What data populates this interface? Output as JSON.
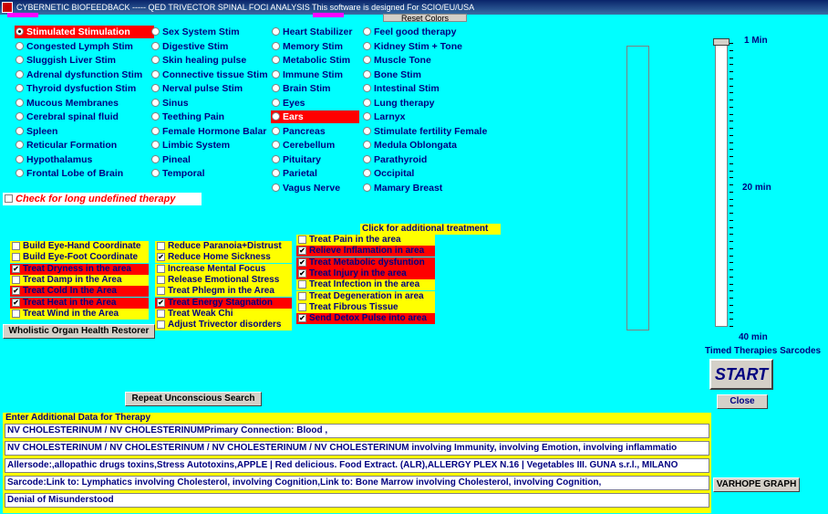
{
  "window": {
    "title": "CYBERNETIC BIOFEEDBACK  -----  QED   TRIVECTOR SPINAL FOCI ANALYSIS   This software is designed For SCIO/EU/USA",
    "reset_label": "Reset Colors"
  },
  "radios": {
    "col1": [
      {
        "label": "Stimulated Stimulation",
        "selected": true,
        "highlight": "red"
      },
      {
        "label": "Congested Lymph Stim"
      },
      {
        "label": "Sluggish Liver Stim"
      },
      {
        "label": "Adrenal dysfunction Stim"
      },
      {
        "label": "Thyroid dysfuction Stim"
      },
      {
        "label": "Mucous Membranes"
      },
      {
        "label": "Cerebral spinal fluid"
      },
      {
        "label": "Spleen"
      },
      {
        "label": "Reticular Formation"
      },
      {
        "label": "Hypothalamus"
      },
      {
        "label": "Frontal Lobe of Brain"
      }
    ],
    "col2": [
      {
        "label": "Sex System Stim"
      },
      {
        "label": "Digestive Stim"
      },
      {
        "label": "Skin healing pulse"
      },
      {
        "label": "Connective tissue Stim"
      },
      {
        "label": "Nerval pulse Stim"
      },
      {
        "label": "Sinus"
      },
      {
        "label": "Teething Pain"
      },
      {
        "label": "Female Hormone Balar"
      },
      {
        "label": "Limbic System"
      },
      {
        "label": "Pineal"
      },
      {
        "label": "Temporal"
      }
    ],
    "col3": [
      {
        "label": "Heart Stabilizer"
      },
      {
        "label": "Memory Stim"
      },
      {
        "label": "Metabolic Stim"
      },
      {
        "label": "Immune Stim"
      },
      {
        "label": "Brain Stim"
      },
      {
        "label": "Eyes"
      },
      {
        "label": "Ears",
        "highlight": "red"
      },
      {
        "label": "Pancreas"
      },
      {
        "label": "Cerebellum"
      },
      {
        "label": "Pituitary"
      },
      {
        "label": "Parietal"
      },
      {
        "label": "Vagus Nerve"
      }
    ],
    "col4": [
      {
        "label": "Feel good therapy"
      },
      {
        "label": "Kidney Stim + Tone"
      },
      {
        "label": "Muscle Tone"
      },
      {
        "label": "Bone Stim"
      },
      {
        "label": "Intestinal Stim"
      },
      {
        "label": "Lung therapy"
      },
      {
        "label": "Larnyx"
      },
      {
        "label": "Stimulate fertility Female"
      },
      {
        "label": "Medula Oblongata"
      },
      {
        "label": "Parathyroid"
      },
      {
        "label": "Occipital"
      },
      {
        "label": "Mamary  Breast"
      }
    ]
  },
  "long_therapy_label": "Check for long undefined therapy",
  "checks": {
    "group1": [
      {
        "label": "Build Eye-Hand Coordinate",
        "checked": false,
        "bg": "yellow"
      },
      {
        "label": "Build Eye-Foot Coordinate",
        "checked": false,
        "bg": "yellow"
      },
      {
        "label": "Treat Dryness in the area",
        "checked": true,
        "bg": "red"
      },
      {
        "label": "Treat Damp in the Area",
        "checked": false,
        "bg": "yellow"
      },
      {
        "label": "Treat Cold In the Area",
        "checked": true,
        "bg": "red"
      },
      {
        "label": "Treat Heat in the Area",
        "checked": true,
        "bg": "red"
      },
      {
        "label": "Treat Wind in the Area",
        "checked": false,
        "bg": "yellow"
      }
    ],
    "group2": [
      {
        "label": "Reduce Paranoia+Distrust",
        "checked": false,
        "bg": "yellow"
      },
      {
        "label": "Reduce Home Sickness",
        "checked": true,
        "bg": "yellow"
      },
      {
        "label": "Increase Mental Focus",
        "checked": false,
        "bg": "yellow"
      },
      {
        "label": "Release Emotional Stress",
        "checked": false,
        "bg": "yellow"
      },
      {
        "label": "Treat  Phlegm in the Area",
        "checked": false,
        "bg": "yellow"
      },
      {
        "label": "Treat Energy Stagnation",
        "checked": true,
        "bg": "red"
      },
      {
        "label": "Treat Weak Chi",
        "checked": false,
        "bg": "yellow"
      },
      {
        "label": "Adjust Trivector disorders",
        "checked": false,
        "bg": "yellow"
      }
    ],
    "additional_title": "Click for additional treatment",
    "group3": [
      {
        "label": "Treat Pain in the area",
        "checked": false,
        "bg": "yellow"
      },
      {
        "label": "Relieve Inflamation in area",
        "checked": true,
        "bg": "red"
      },
      {
        "label": "Treat Metabolic dysfuntion",
        "checked": true,
        "bg": "red"
      },
      {
        "label": "Treat Injury in the area",
        "checked": true,
        "bg": "red"
      },
      {
        "label": "Treat Infection in the area",
        "checked": false,
        "bg": "yellow"
      },
      {
        "label": "Treat Degeneration in area",
        "checked": false,
        "bg": "yellow"
      },
      {
        "label": "Treat Fibrous Tissue",
        "checked": false,
        "bg": "yellow"
      },
      {
        "label": "Send Detox Pulse into area",
        "checked": true,
        "bg": "red"
      }
    ]
  },
  "buttons": {
    "wholistic": "Wholistic Organ Health Restorer",
    "repeat": "Repeat Unconscious Search",
    "start": "START",
    "close": "Close",
    "varhope": "VARHOPE GRAPH"
  },
  "slider": {
    "top_label": "1 Min",
    "mid_label": "20 min",
    "bottom_label": "40 min",
    "caption": "Timed Therapies Sarcodes",
    "value_min": 1
  },
  "data_panel": {
    "title": "Enter Additional Data for Therapy",
    "lines": [
      "NV CHOLESTERINUM / NV CHOLESTERINUMPrimary Connection: Blood ,",
      "NV CHOLESTERINUM / NV CHOLESTERINUM / NV CHOLESTERINUM / NV CHOLESTERINUM involving Immunity, involving Emotion, involving inflammatio",
      "Allersode:,allopathic drugs toxins,Stress Autotoxins,APPLE | Red delicious. Food Extract. (ALR),ALLERGY PLEX N.16 | Vegetables III. GUNA s.r.l., MILANO",
      "Sarcode:Link to: Lymphatics involving Cholesterol, involving Cognition,Link to: Bone Marrow involving Cholesterol, involving Cognition,",
      "Denial of Misunderstood"
    ]
  }
}
